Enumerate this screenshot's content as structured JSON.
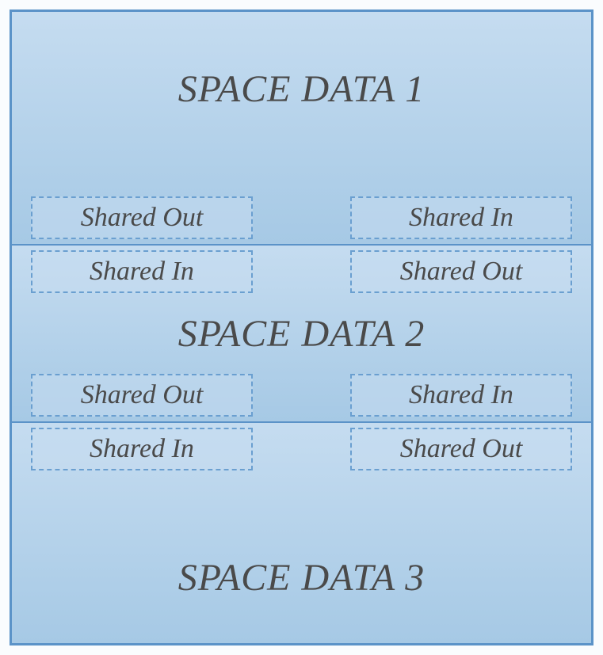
{
  "spaces": [
    {
      "title": "SPACE DATA 1",
      "bottom": {
        "left": "Shared Out",
        "right": "Shared In"
      }
    },
    {
      "title": "SPACE DATA 2",
      "top": {
        "left": "Shared In",
        "right": "Shared Out"
      },
      "bottom": {
        "left": "Shared Out",
        "right": "Shared In"
      }
    },
    {
      "title": "SPACE DATA 3",
      "top": {
        "left": "Shared In",
        "right": "Shared Out"
      }
    }
  ]
}
